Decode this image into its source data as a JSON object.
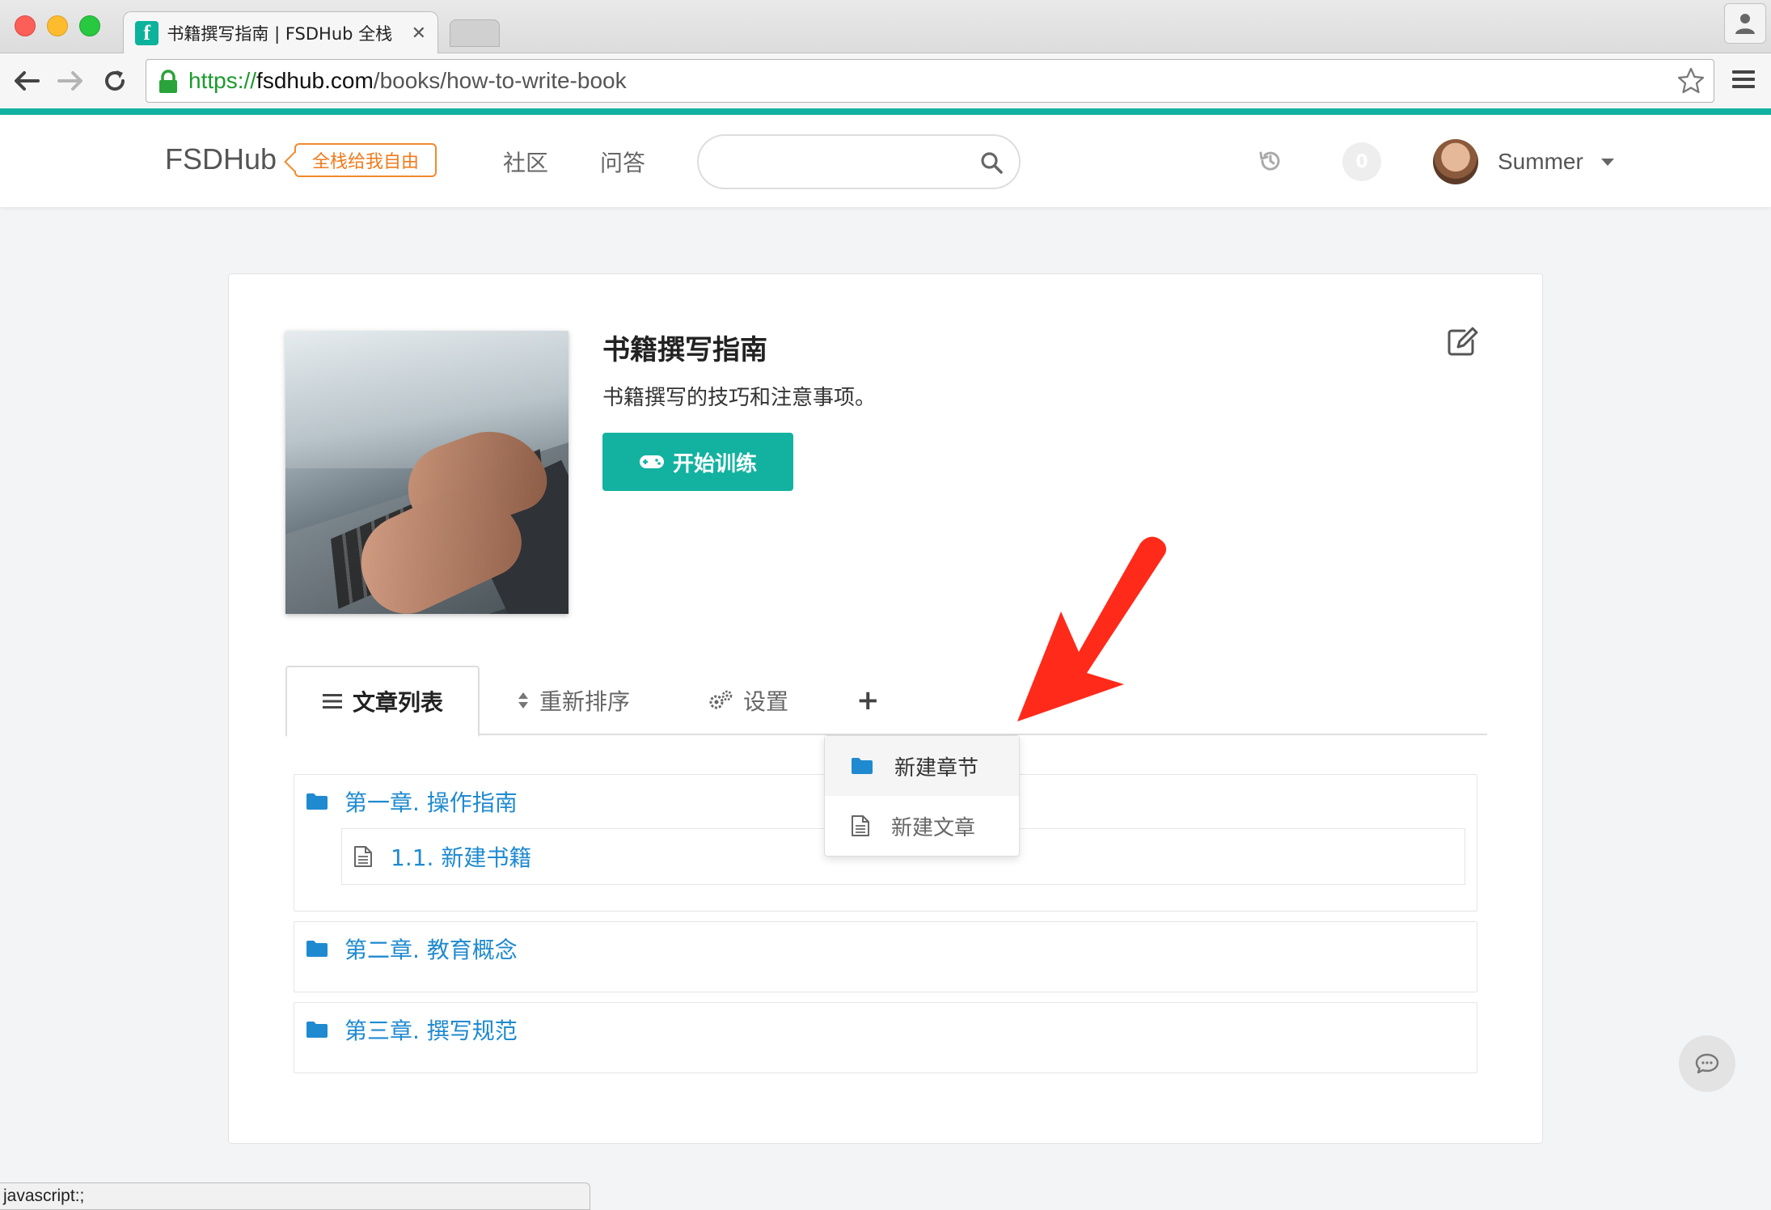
{
  "browser": {
    "tab_title": "书籍撰写指南 | FSDHub 全栈",
    "tab_close": "✕",
    "url_scheme": "https://",
    "url_host": "fsdhub.com",
    "url_path": "/books/how-to-write-book"
  },
  "header": {
    "brand": "FSDHub",
    "slogan": "全栈给我自由",
    "nav": [
      "社区",
      "问答"
    ],
    "search_placeholder": "",
    "notification_count": "0",
    "username": "Summer"
  },
  "book": {
    "title": "书籍撰写指南",
    "description": "书籍撰写的技巧和注意事项。",
    "start_label": "开始训练"
  },
  "tabs": {
    "list": "文章列表",
    "reorder": "重新排序",
    "settings": "设置",
    "add": "+"
  },
  "dropdown": {
    "new_chapter": "新建章节",
    "new_article": "新建文章"
  },
  "chapters": [
    {
      "title": "第一章. 操作指南",
      "articles": [
        {
          "title": "1.1. 新建书籍"
        }
      ]
    },
    {
      "title": "第二章. 教育概念",
      "articles": []
    },
    {
      "title": "第三章. 撰写规范",
      "articles": []
    }
  ],
  "status_bar": "javascript:;",
  "colors": {
    "accent": "#13b2a0",
    "link": "#1f8ad0",
    "slogan": "#f07a1c",
    "annotation_arrow": "#ff2a1a"
  },
  "icons": {
    "back": "arrow-left-icon",
    "forward": "arrow-right-icon",
    "reload": "reload-icon",
    "lock": "lock-icon",
    "bookmark": "star-icon",
    "menu": "hamburger-icon",
    "search": "search-icon",
    "history": "history-icon",
    "edit": "edit-icon",
    "gamepad": "gamepad-icon",
    "folder": "folder-icon",
    "document": "document-icon",
    "chat": "chat-icon"
  }
}
